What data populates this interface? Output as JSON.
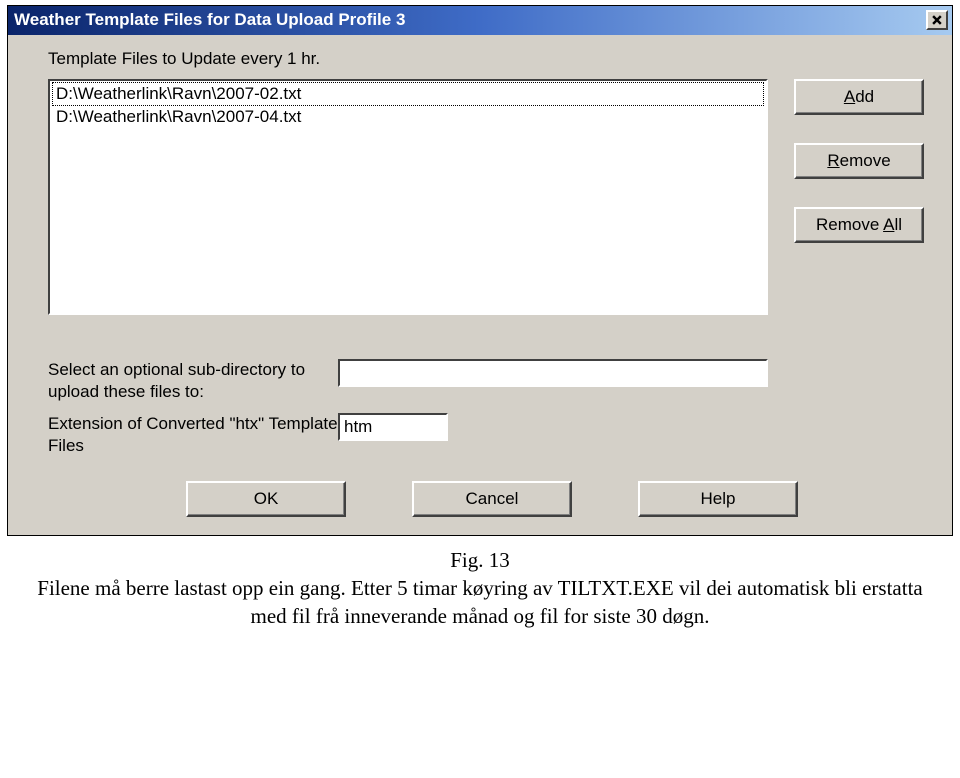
{
  "window": {
    "title": "Weather Template Files for Data Upload Profile 3"
  },
  "sectionLabel": "Template Files to Update every 1 hr.",
  "listbox": {
    "items": [
      "D:\\Weatherlink\\Ravn\\2007-02.txt",
      "D:\\Weatherlink\\Ravn\\2007-04.txt"
    ],
    "selectedIndex": 0
  },
  "buttons": {
    "add": "Add",
    "remove": "Remove",
    "removeAll": "Remove All",
    "ok": "OK",
    "cancel": "Cancel",
    "help": "Help"
  },
  "subdir": {
    "label": "Select an optional sub-directory to upload these files to:",
    "value": ""
  },
  "extension": {
    "label": "Extension of Converted \"htx\" Template Files",
    "value": "htm"
  },
  "caption": {
    "figLabel": "Fig. 13",
    "text": "Filene må berre lastast opp ein gang. Etter 5 timar køyring av TILTXT.EXE vil dei automatisk bli erstatta med fil frå inneverande månad og fil for siste 30 døgn."
  }
}
